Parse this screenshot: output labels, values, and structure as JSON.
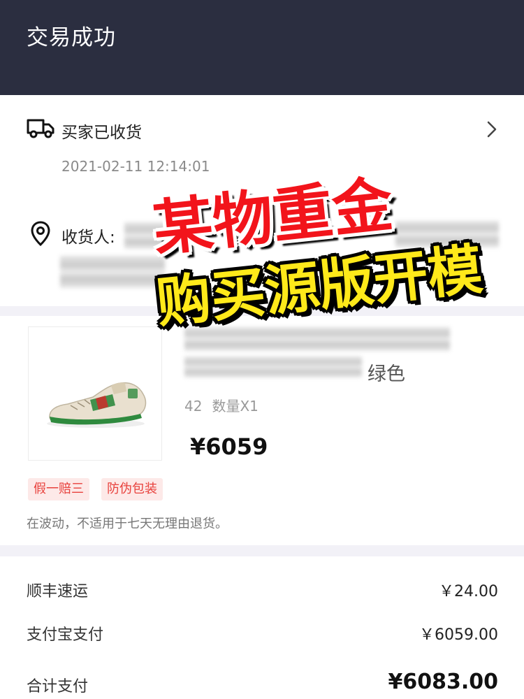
{
  "header": {
    "title": "交易成功"
  },
  "logistics": {
    "status_label": "买家已收货",
    "status_time": "2021-02-11 12:14:01",
    "receiver_label": "收货人:"
  },
  "overlay": {
    "line1": "某物重金",
    "line2": "购买源版开模"
  },
  "product": {
    "color": "绿色",
    "size": "42",
    "quantity": "数量X1",
    "price": "¥6059"
  },
  "tags": [
    "假一赔三",
    "防伪包装"
  ],
  "notice": "在波动，不适用于七天无理由退货。",
  "payment": {
    "rows": [
      {
        "label": "顺丰速运",
        "value": "￥24.00"
      },
      {
        "label": "支付宝支付",
        "value": "￥6059.00"
      },
      {
        "label": "合计支付",
        "value": "¥6083.00"
      }
    ]
  },
  "colors": {
    "header_bg": "#2b2e40",
    "overlay_red": "#f2141b",
    "overlay_yellow": "#ffe91a",
    "tag_text": "#e8413c",
    "tag_bg": "#fde9e8"
  },
  "icons": [
    "truck-icon",
    "chevron-right-icon",
    "location-pin-icon"
  ]
}
